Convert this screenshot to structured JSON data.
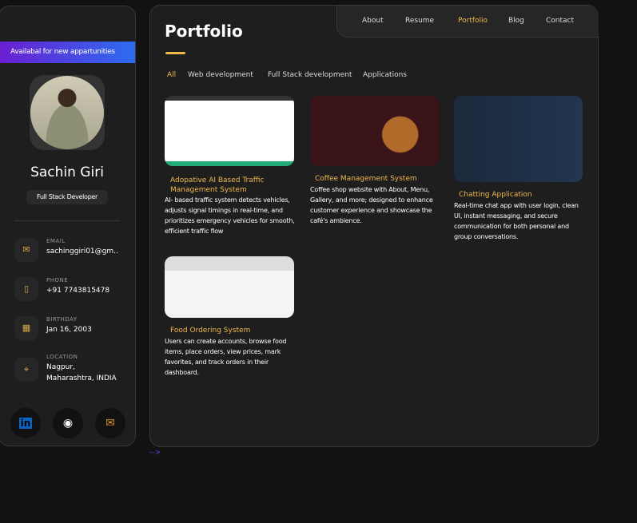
{
  "sidebar": {
    "availability": "Availabal for new appartunities",
    "name": "Sachin Giri",
    "role": "Full Stack Developer",
    "contacts": [
      {
        "label": "EMAIL",
        "value": "sachinggiri01@gm..",
        "icon": "mail-icon"
      },
      {
        "label": "PHONE",
        "value": "+91 7743815478",
        "icon": "phone-icon"
      },
      {
        "label": "BIRTHDAY",
        "value": "Jan 16, 2003",
        "icon": "calendar-icon"
      },
      {
        "label": "LOCATION",
        "value": "Nagpur,",
        "value2": "Maharashtra, INDIA",
        "icon": "location-icon"
      }
    ],
    "social": {
      "linkedin": "in",
      "github": "◉",
      "mail": "✉"
    }
  },
  "nav": [
    "About",
    "Resume",
    "Portfolio",
    "Blog",
    "Contact"
  ],
  "main": {
    "title": "Portfolio",
    "filters": [
      "All",
      "Web development",
      "Full Stack development",
      "Applications"
    ],
    "projects": [
      {
        "title": "Adopative AI Based Traffic Management System",
        "desc": "AI- based traffic system detects vehicles, adjusts signal timings in real-time, and prioritizes emergency vehicles for smooth, efficient traffic flow"
      },
      {
        "title": "Coffee Management System",
        "desc": "Coffee shop website with About, Menu, Gallery, and more; designed to enhance customer experience and showcase the café's ambience."
      },
      {
        "title": "Chatting Application",
        "desc": "Real-time chat app with user login, clean UI, instant messaging, and secure communication for both personal and group conversations."
      },
      {
        "title": "Food Ordering System",
        "desc": "Users can create accounts, browse food items, place orders, view prices, mark favorites, and track orders in their dashboard."
      }
    ]
  },
  "footer_text": "-->",
  "colors": {
    "accent": "#f2b84b",
    "bg": "#121212",
    "card": "#1e1e1f"
  }
}
